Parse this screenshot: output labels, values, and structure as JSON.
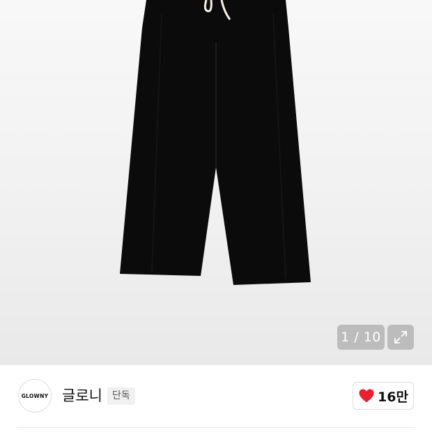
{
  "gallery": {
    "counter_text": "1 / 10",
    "image_icon": "black-wide-pants-photo",
    "expand_icon": "expand-arrows-icon"
  },
  "brand": {
    "logo_text": "GLOWNY",
    "name": "글로니",
    "badge": "단독"
  },
  "like": {
    "icon": "heart-icon",
    "count": "16만",
    "heart_color": "#e8202f"
  }
}
